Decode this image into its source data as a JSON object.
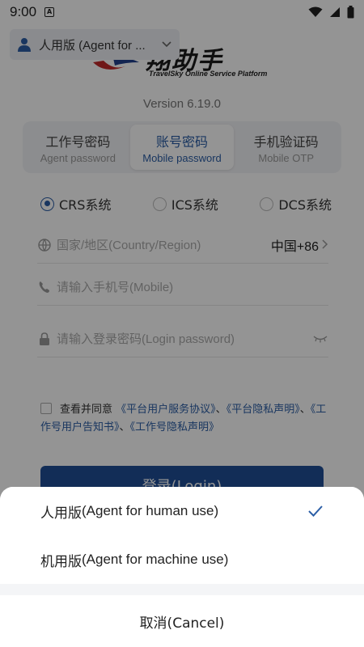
{
  "status_bar": {
    "time": "9:00",
    "notification_icon": "A"
  },
  "mode_select": {
    "label": "人用版 (Agent for ..."
  },
  "logo": {
    "title": "翔助手",
    "subtitle": "TravelSky Online Service Platform"
  },
  "version": "Version 6.19.0",
  "tabs": [
    {
      "zh": "工作号密码",
      "en": "Agent password"
    },
    {
      "zh": "账号密码",
      "en": "Mobile password"
    },
    {
      "zh": "手机验证码",
      "en": "Mobile OTP"
    }
  ],
  "systems": [
    {
      "label": "CRS系统"
    },
    {
      "label": "ICS系统"
    },
    {
      "label": "DCS系统"
    }
  ],
  "fields": {
    "region": {
      "placeholder": "国家/地区(Country/Region)",
      "value": "中国+86"
    },
    "mobile": {
      "placeholder": "请输入手机号(Mobile)"
    },
    "password": {
      "placeholder": "请输入登录密码(Login password)"
    }
  },
  "agreement": {
    "prefix": "查看并同意",
    "link1": "《平台用户服务协议》",
    "sep1": "、",
    "link2": "《平台隐私声明》",
    "sep2": "、",
    "link3": "《工作号用户告知书》",
    "sep3": "、",
    "link4": "《工作号隐私声明》"
  },
  "login_button": "登录(Login)",
  "sheet": {
    "options": [
      {
        "zh": "人用版",
        "en": " (Agent for human use)",
        "selected": true
      },
      {
        "zh": "机用版",
        "en": " (Agent for machine use)",
        "selected": false
      }
    ],
    "cancel": "取消(Cancel)"
  },
  "colors": {
    "accent": "#2b5ea6",
    "button": "#1f4e96"
  }
}
